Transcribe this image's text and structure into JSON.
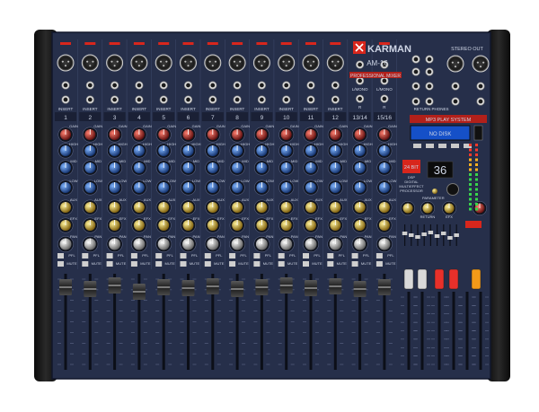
{
  "brand": {
    "logo_text": "KARMAN",
    "model": "AM-16",
    "tagline": "PROFESSIONAL MIXER"
  },
  "channels": {
    "mono_labels": [
      "1",
      "2",
      "3",
      "4",
      "5",
      "6",
      "7",
      "8",
      "9",
      "10",
      "11",
      "12"
    ],
    "stereo_labels": [
      "13/14",
      "15/16"
    ],
    "row_labels": {
      "insert": "INSERT",
      "gain": "GAIN",
      "high": "HIGH",
      "mid": "MID",
      "low": "LOW",
      "aux": "AUX",
      "efx": "EFX",
      "pan": "PAN",
      "pfl": "PFL",
      "mute": "MUTE"
    }
  },
  "stereo_input_labels": {
    "l_mono": "L/MONO",
    "r": "R"
  },
  "master_section": {
    "stereo_out": "STEREO OUT",
    "mp3_title": "MP3 PLAY SYSTEM",
    "mp3_display_text": "NO DISK",
    "efx_display_value": "36",
    "dsp_badge": "24 BIT",
    "dsp_caption_1": "DSP",
    "dsp_caption_2": "DIGITAL",
    "dsp_caption_3": "MULTIEFFECT",
    "dsp_caption_4": "PROCESSOR",
    "return_label": "RETURN",
    "phones_label": "PHONES",
    "aux_label": "AUX",
    "efx_label": "EFX",
    "parameter_label": "PARAMETER"
  },
  "colors": {
    "panel": "#262f4a",
    "panel_dark": "#1c2338",
    "accent_red": "#d8261c",
    "display_blue": "#2d7cf5",
    "led_red": "#ff3a2a",
    "knob_gain": "#a12c2c",
    "knob_eq": "#2f64b3",
    "knob_aux": "#caa125",
    "knob_pan": "#d9d9d9"
  }
}
